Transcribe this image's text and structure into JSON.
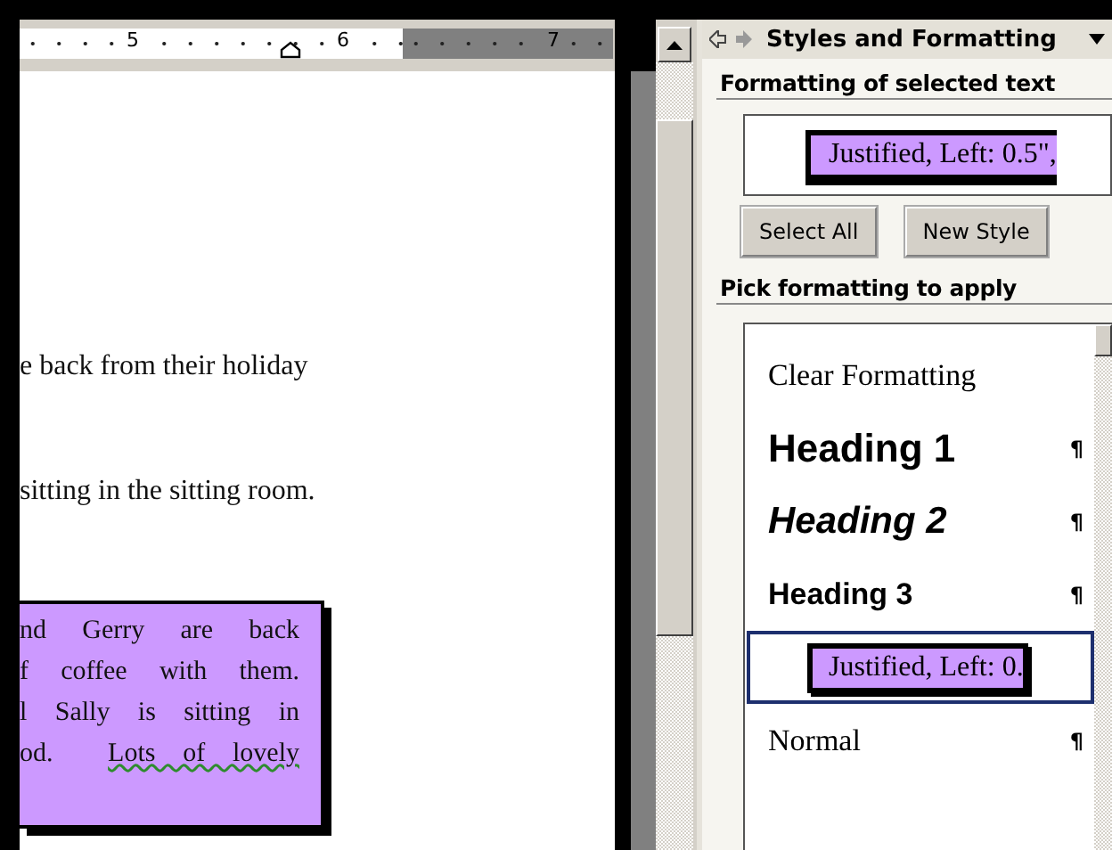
{
  "ruler": {
    "labels": [
      "5",
      "6",
      "7"
    ]
  },
  "document": {
    "lines": [
      "e back from their holiday",
      "sitting in the sitting room."
    ],
    "text_box": {
      "lines": [
        {
          "text": "nd Gerry are back"
        },
        {
          "text": "f coffee with them."
        },
        {
          "text": "l Sally is sitting in"
        },
        {
          "text": "od.",
          "flagged_text": "Lots of lovely"
        }
      ]
    }
  },
  "panel": {
    "title": "Styles and Formatting",
    "selected_section": {
      "heading": "Formatting of selected text",
      "current_style": "Justified, Left:  0.5\","
    },
    "buttons": [
      "Select All",
      "New Style"
    ],
    "apply_section": {
      "heading": "Pick formatting to apply",
      "styles": [
        {
          "kind": "clear",
          "label": "Clear Formatting",
          "selected": false
        },
        {
          "kind": "heading1",
          "label": "Heading 1",
          "mark": "¶",
          "selected": false
        },
        {
          "kind": "heading2",
          "label": "Heading 2",
          "mark": "¶",
          "selected": false
        },
        {
          "kind": "heading3",
          "label": "Heading 3",
          "mark": "¶",
          "selected": false
        },
        {
          "kind": "preview",
          "label": "Justified, Left:  0.",
          "selected": true
        },
        {
          "kind": "normal",
          "label": "Normal",
          "mark": "¶",
          "selected": false
        }
      ]
    }
  }
}
